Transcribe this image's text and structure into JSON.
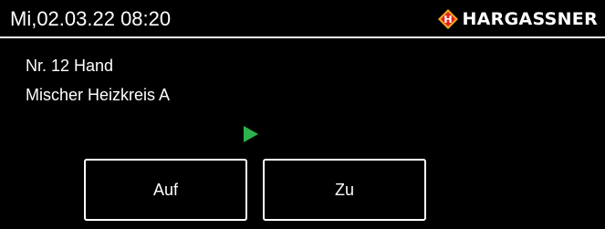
{
  "header": {
    "datetime": "Mi,02.03.22 08:20",
    "brand": "HARGASSNER",
    "logo_icon": "hargassner-h-diamond-icon",
    "logo_colors": {
      "outer": "#f5a623",
      "inner": "#e32119",
      "letter": "#ffffff"
    }
  },
  "info": {
    "line1": "Nr. 12 Hand",
    "line2": "Mischer Heizkreis A"
  },
  "indicator": {
    "icon": "play-icon",
    "color": "#2bb24c"
  },
  "buttons": {
    "up_label": "Auf",
    "down_label": "Zu"
  }
}
